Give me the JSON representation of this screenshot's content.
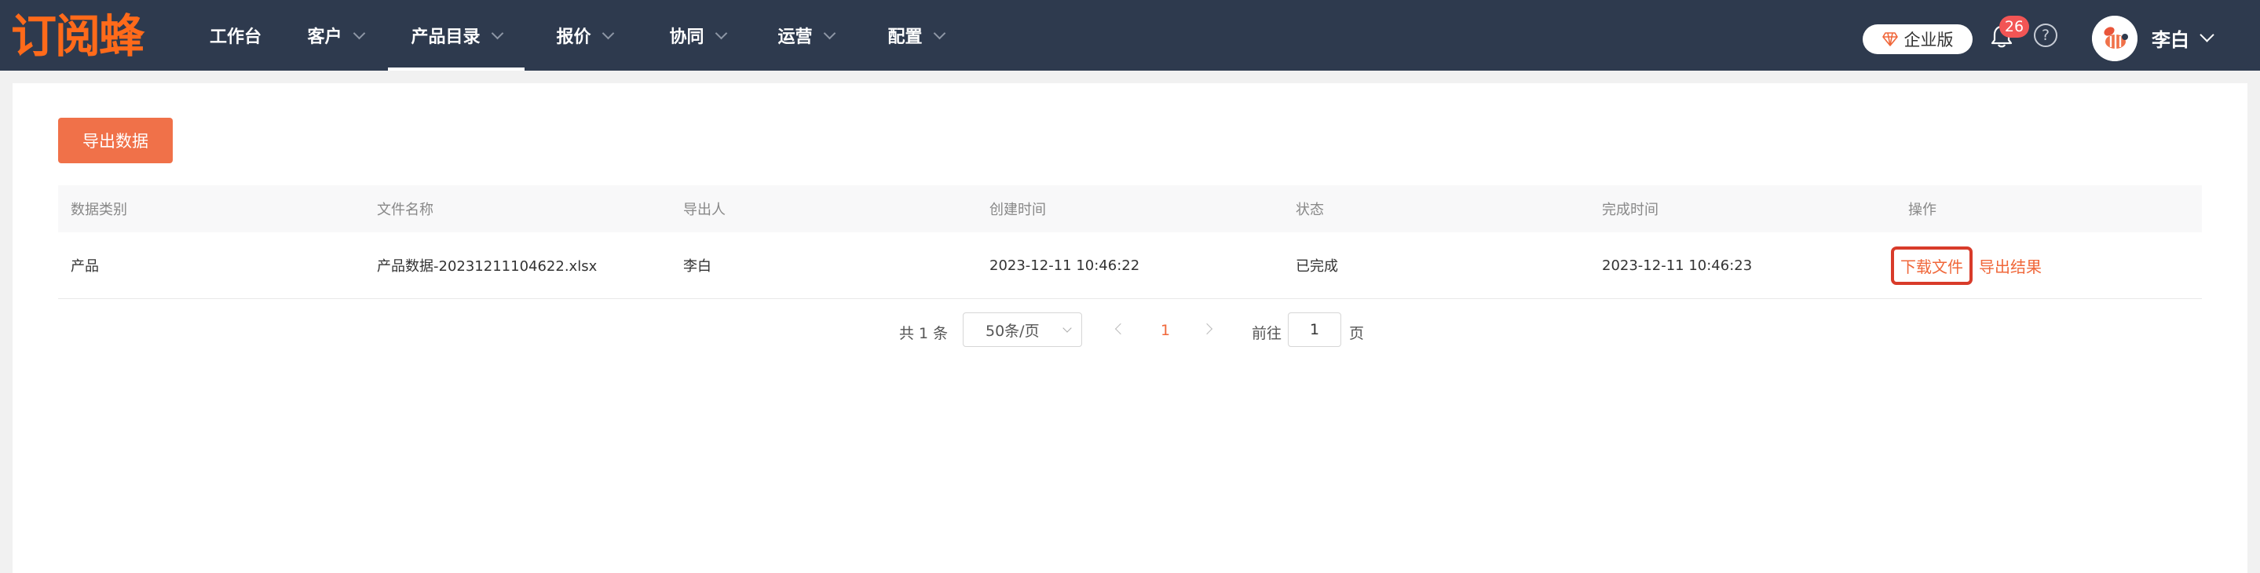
{
  "brand": {
    "logo_text": "订阅蜂"
  },
  "nav": {
    "items": [
      {
        "label": "工作台",
        "has_dropdown": false,
        "active": false
      },
      {
        "label": "客户",
        "has_dropdown": true,
        "active": false
      },
      {
        "label": "产品目录",
        "has_dropdown": true,
        "active": true
      },
      {
        "label": "报价",
        "has_dropdown": true,
        "active": false
      },
      {
        "label": "协同",
        "has_dropdown": true,
        "active": false
      },
      {
        "label": "运营",
        "has_dropdown": true,
        "active": false
      },
      {
        "label": "配置",
        "has_dropdown": true,
        "active": false
      }
    ]
  },
  "header": {
    "edition_label": "企业版",
    "notification_count": "26",
    "help_symbol": "?",
    "user_name": "李白"
  },
  "toolbar": {
    "export_label": "导出数据"
  },
  "table": {
    "columns": [
      "数据类别",
      "文件名称",
      "导出人",
      "创建时间",
      "状态",
      "完成时间",
      "操作"
    ],
    "rows": [
      {
        "category": "产品",
        "file_name": "产品数据-20231211104622.xlsx",
        "exporter": "李白",
        "created_at": "2023-12-11 10:46:22",
        "status": "已完成",
        "completed_at": "2023-12-11 10:46:23",
        "actions": {
          "download": "下载文件",
          "result": "导出结果"
        }
      }
    ]
  },
  "pagination": {
    "total_text": "共 1 条",
    "page_size": "50条/页",
    "current_page": "1",
    "goto_label": "前往",
    "goto_value": "1",
    "page_unit": "页"
  },
  "colors": {
    "nav_bg": "#2e3a4e",
    "brand": "#ff6a1a",
    "accent": "#f07149",
    "link": "#f0673a",
    "highlight_border": "#d83b2a",
    "badge": "#f25555"
  }
}
